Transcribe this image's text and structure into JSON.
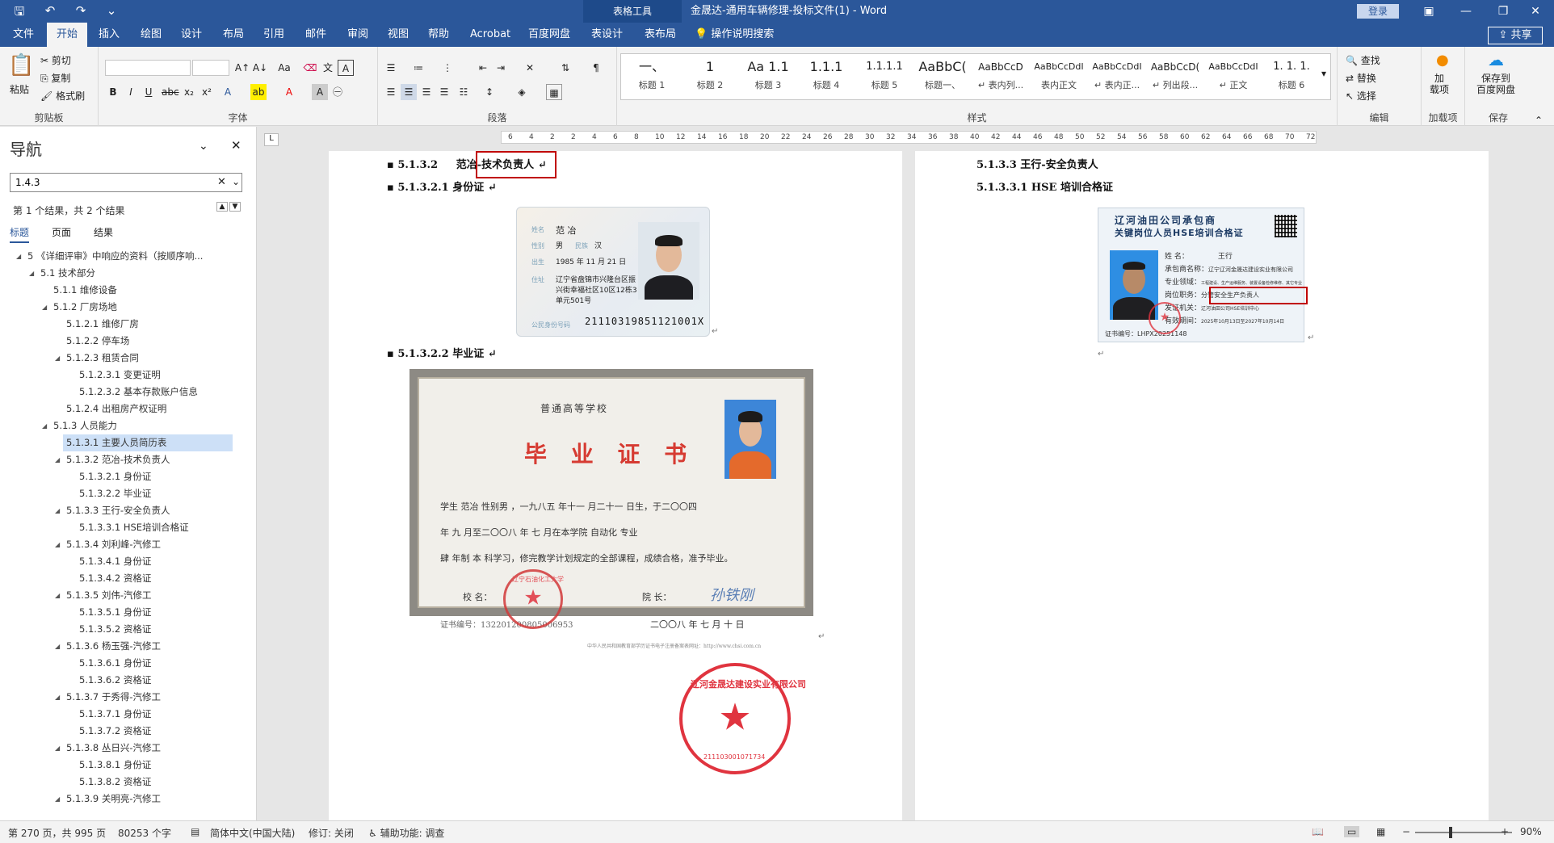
{
  "window": {
    "title": "金晟达-通用车辆修理-投标文件(1)  -  Word",
    "context_tools": "表格工具",
    "login": "登录",
    "minimize": "—",
    "restore": "❐",
    "close": "✕",
    "ribbon_toggle": "▣"
  },
  "qat": {
    "save": "🖫",
    "undo": "↶",
    "redo": "↷",
    "customize": "⌄"
  },
  "tabs": [
    "文件",
    "开始",
    "插入",
    "绘图",
    "设计",
    "布局",
    "引用",
    "邮件",
    "审阅",
    "视图",
    "帮助",
    "Acrobat",
    "百度网盘",
    "表设计",
    "表布局"
  ],
  "active_tab": "开始",
  "tell_me": "操作说明搜索",
  "share": "共享",
  "ribbon": {
    "clipboard": {
      "label": "剪贴板",
      "paste": "粘贴",
      "cut": "剪切",
      "copy": "复制",
      "painter": "格式刷"
    },
    "font": {
      "label": "字体",
      "font_name": "",
      "font_size": ""
    },
    "paragraph": {
      "label": "段落"
    },
    "styles": {
      "label": "样式",
      "items": [
        {
          "sample": "一、",
          "name": "标题 1"
        },
        {
          "sample": "1",
          "name": "标题 2"
        },
        {
          "sample": "Aa  1.1",
          "name": "标题 3"
        },
        {
          "sample": "1.1.1",
          "name": "标题 4"
        },
        {
          "sample": "1.1.1.1",
          "name": "标题 5"
        },
        {
          "sample": "AaBbC(",
          "name": "标题一、"
        },
        {
          "sample": "AaBbCcD",
          "name": "↵ 表内列..."
        },
        {
          "sample": "AaBbCcDdI",
          "name": "表内正文"
        },
        {
          "sample": "AaBbCcDdI",
          "name": "↵ 表内正..."
        },
        {
          "sample": "AaBbCcD(",
          "name": "↵ 列出段..."
        },
        {
          "sample": "AaBbCcDdI",
          "name": "↵ 正文"
        },
        {
          "sample": "1. 1. 1.",
          "name": "标题 6"
        }
      ]
    },
    "editing": {
      "label": "编辑",
      "find": "查找",
      "replace": "替换",
      "select": "选择"
    },
    "addins": {
      "label": "加载项",
      "button": "加\n载项"
    },
    "save": {
      "label": "保存",
      "button": "保存到\n百度网盘"
    }
  },
  "nav": {
    "title": "导航",
    "search_value": "1.4.3",
    "results_text": "第 1 个结果，共 2 个结果",
    "tabs": [
      "标题",
      "页面",
      "结果"
    ],
    "active_tab": "标题",
    "items": [
      {
        "text": "5 《详细评审》中响应的资料（按顺序响...",
        "level": 0,
        "toggle": true
      },
      {
        "text": "5.1 技术部分",
        "level": 1,
        "toggle": true
      },
      {
        "text": "5.1.1 维修设备",
        "level": 2,
        "toggle": false
      },
      {
        "text": "5.1.2 厂房场地",
        "level": 2,
        "toggle": true
      },
      {
        "text": "5.1.2.1 维修厂房",
        "level": 3,
        "toggle": false
      },
      {
        "text": "5.1.2.2 停车场",
        "level": 3,
        "toggle": false
      },
      {
        "text": "5.1.2.3 租赁合同",
        "level": 3,
        "toggle": true
      },
      {
        "text": "5.1.2.3.1 变更证明",
        "level": 4,
        "toggle": false
      },
      {
        "text": "5.1.2.3.2 基本存款账户信息",
        "level": 4,
        "toggle": false
      },
      {
        "text": "5.1.2.4 出租房产权证明",
        "level": 3,
        "toggle": false
      },
      {
        "text": "5.1.3 人员能力",
        "level": 2,
        "toggle": true
      },
      {
        "text": "5.1.3.1 主要人员简历表",
        "level": 3,
        "toggle": false,
        "selected": true
      },
      {
        "text": "5.1.3.2 范冶-技术负责人",
        "level": 3,
        "toggle": true
      },
      {
        "text": "5.1.3.2.1 身份证",
        "level": 4,
        "toggle": false
      },
      {
        "text": "5.1.3.2.2 毕业证",
        "level": 4,
        "toggle": false
      },
      {
        "text": "5.1.3.3 王行-安全负责人",
        "level": 3,
        "toggle": true
      },
      {
        "text": "5.1.3.3.1 HSE培训合格证",
        "level": 4,
        "toggle": false
      },
      {
        "text": "5.1.3.4 刘利峰-汽修工",
        "level": 3,
        "toggle": true
      },
      {
        "text": "5.1.3.4.1 身份证",
        "level": 4,
        "toggle": false
      },
      {
        "text": "5.1.3.4.2 资格证",
        "level": 4,
        "toggle": false
      },
      {
        "text": "5.1.3.5 刘伟-汽修工",
        "level": 3,
        "toggle": true
      },
      {
        "text": "5.1.3.5.1 身份证",
        "level": 4,
        "toggle": false
      },
      {
        "text": "5.1.3.5.2 资格证",
        "level": 4,
        "toggle": false
      },
      {
        "text": "5.1.3.6 杨玉强-汽修工",
        "level": 3,
        "toggle": true
      },
      {
        "text": "5.1.3.6.1 身份证",
        "level": 4,
        "toggle": false
      },
      {
        "text": "5.1.3.6.2 资格证",
        "level": 4,
        "toggle": false
      },
      {
        "text": "5.1.3.7 于秀得-汽修工",
        "level": 3,
        "toggle": true
      },
      {
        "text": "5.1.3.7.1 身份证",
        "level": 4,
        "toggle": false
      },
      {
        "text": "5.1.3.7.2 资格证",
        "level": 4,
        "toggle": false
      },
      {
        "text": "5.1.3.8 丛日兴-汽修工",
        "level": 3,
        "toggle": true
      },
      {
        "text": "5.1.3.8.1 身份证",
        "level": 4,
        "toggle": false
      },
      {
        "text": "5.1.3.8.2 资格证",
        "level": 4,
        "toggle": false
      },
      {
        "text": "5.1.3.9 关明亮-汽修工",
        "level": 3,
        "toggle": true
      }
    ]
  },
  "ruler": [
    "6",
    "4",
    "2",
    "2",
    "4",
    "6",
    "8",
    "10",
    "12",
    "14",
    "16",
    "18",
    "20",
    "22",
    "24",
    "26",
    "28",
    "30",
    "32",
    "34",
    "36",
    "38",
    "40",
    "42",
    "44",
    "46",
    "48",
    "50",
    "52",
    "54",
    "56",
    "58",
    "60",
    "62",
    "64",
    "66",
    "68",
    "70",
    "72"
  ],
  "page1": {
    "h1_num": "5.1.3.2",
    "h1_name": "范冶",
    "h1_role": "-技术负责人",
    "h2": "5.1.3.2.1  身份证",
    "h3": "5.1.3.2.2  毕业证",
    "id_card": {
      "name_label": "姓名",
      "name": "范 冶",
      "sex_label": "性别",
      "sex": "男",
      "nation_label": "民族",
      "nation": "汉",
      "birth_label": "出生",
      "birth": "1985  年 11 月 21 日",
      "addr_label": "住址",
      "addr1": "辽宁省盘锦市兴隆台区振",
      "addr2": "兴街幸福社区10区12栋3",
      "addr3": "单元501号",
      "id_label": "公民身份号码",
      "id_number": "21110319851121001X"
    },
    "diploma": {
      "school": "普通高等学校",
      "title": "毕 业 证 书",
      "line1": "学生    范冶      性别男 ，一九八五 年十一 月二十一 日生，于二〇〇四",
      "line2": "年 九 月至二〇〇八 年  七 月在本学院              自动化              专业",
      "line3": "肆 年制  本   科学习，修完教学计划规定的全部课程，成绩合格，准予毕业。",
      "sign_school": "校    名：",
      "sign_dean": "院    长：",
      "dean_signature": "孙铁刚",
      "cert_no": "证书编号：132201200805006953",
      "date": "二〇〇八 年   七 月   十 日",
      "footer": "中华人民共和国教育部学历证书电子注册备案表网址：http://www.chsi.com.cn",
      "seal_text": "辽宁石油化工大学",
      "company_seal": "辽河金晟达建设实业有限公司",
      "company_seal_no": "211103001071734"
    }
  },
  "page2": {
    "h1": "5.1.3.3      王行-安全负责人",
    "h2": "5.1.3.3.1  HSE 培训合格证",
    "hse": {
      "title1": "辽河油田公司承包商",
      "title2": "关键岗位人员HSE培训合格证",
      "name_label": "姓      名：",
      "name": "王行",
      "company_label": "承包商名称：",
      "company": "辽宁辽河金晟达建设实业有限公司",
      "field_label": "专业领域：",
      "field": "工程建设、生产运维服务、装置设备检修维修、其它专业",
      "post_label": "岗位职务：",
      "post": "分管安全生产负责人",
      "issuer_label": "发证机关：",
      "issuer": "辽河油田公司HSE培训中心",
      "valid_label": "有效期间：",
      "valid": "2025年10月13日至2027年10月14日",
      "cert_no": "证书编号：LHPX20251148"
    }
  },
  "status": {
    "page": "第 270 页，共 995 页",
    "words": "80253 个字",
    "language": "简体中文(中国大陆)",
    "track": "修订: 关闭",
    "accessibility": "辅助功能: 调查",
    "zoom": "90%",
    "zoom_minus": "−",
    "zoom_plus": "+"
  },
  "colors": {
    "accent": "#2b579a",
    "red_box": "#c00000",
    "seal_red": "#e0343f"
  }
}
